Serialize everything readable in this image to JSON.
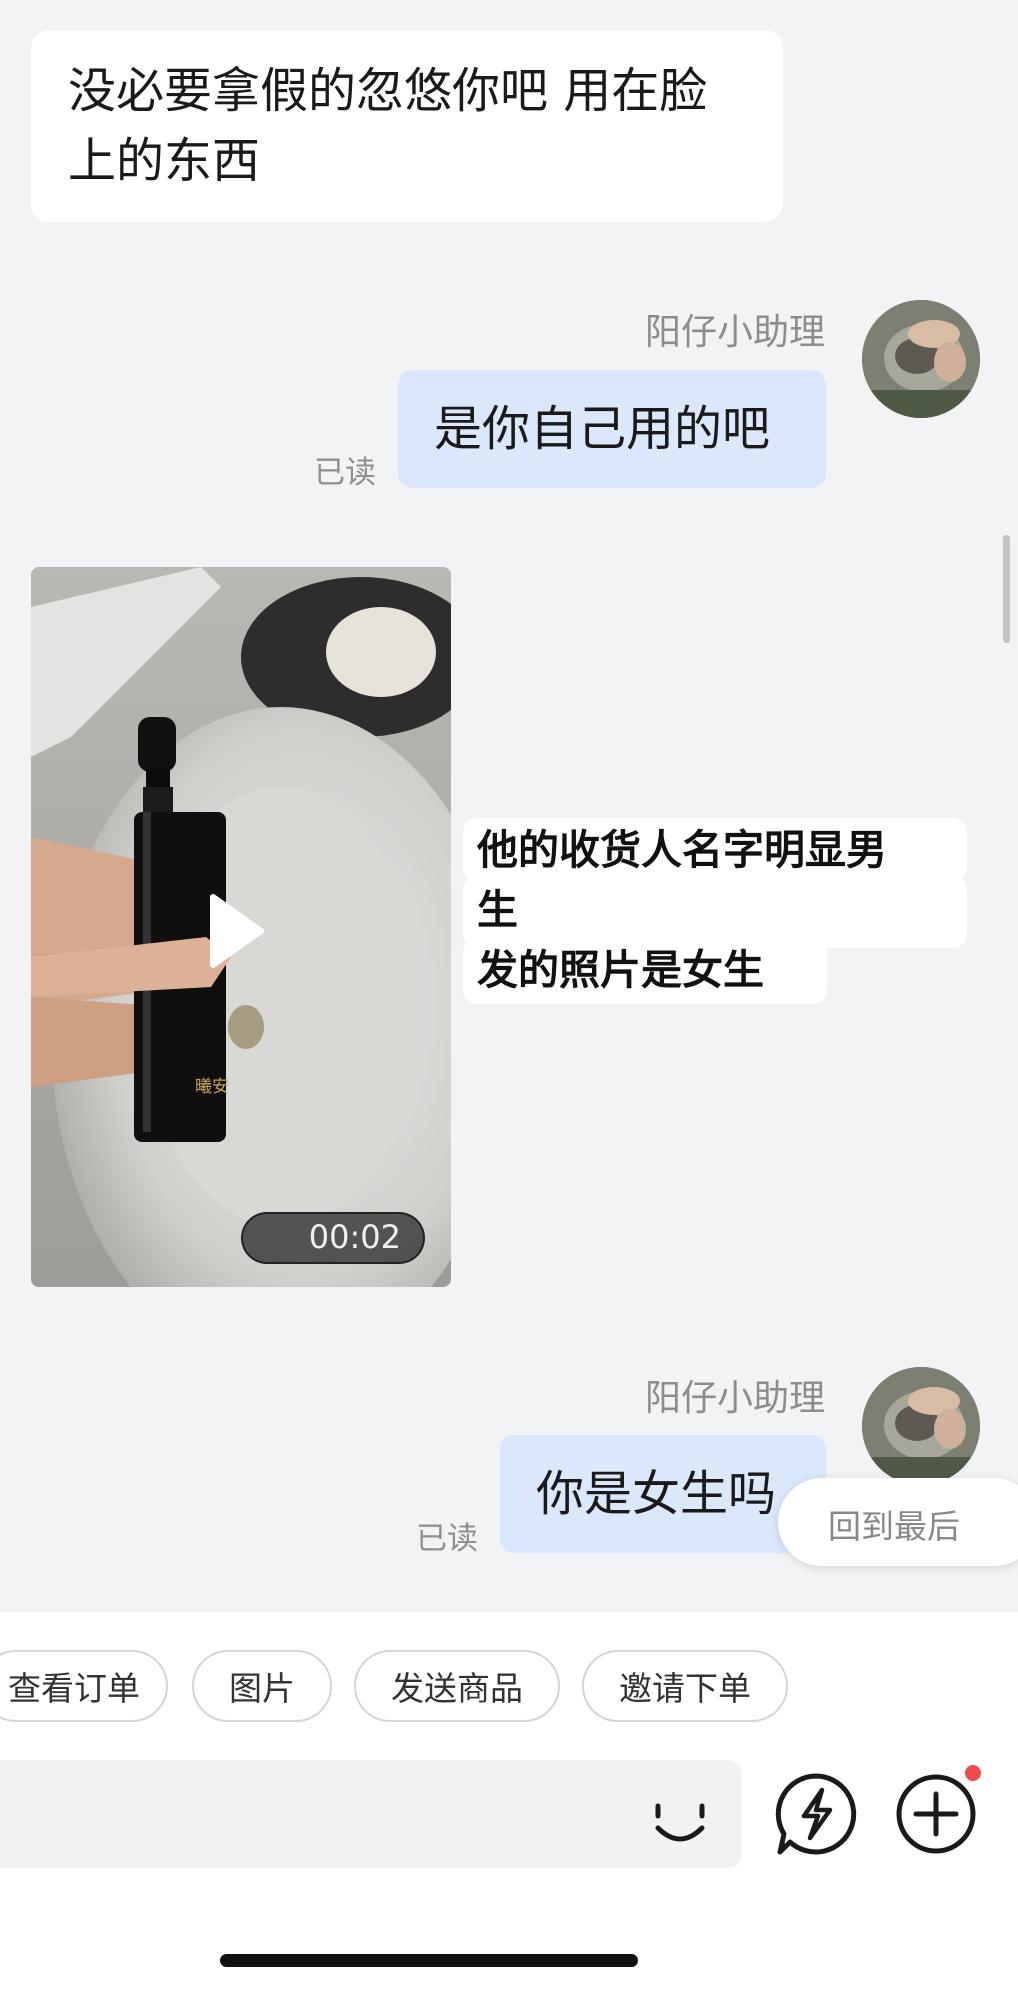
{
  "messages": [
    {
      "id": "m1",
      "side": "incoming",
      "lines": [
        "没必要拿假的忽悠你吧 用在脸",
        "上的东西"
      ]
    },
    {
      "id": "m2",
      "side": "outgoing",
      "sender": "阳仔小助理",
      "text": "是你自己用的吧",
      "read_status": "已读"
    },
    {
      "id": "m3",
      "side": "incoming",
      "type": "video",
      "duration": "00:02",
      "bottle_label": "曦安",
      "caption_lines": [
        "他的收货人名字明显男",
        "生",
        "发的照片是女生"
      ]
    },
    {
      "id": "m4",
      "side": "outgoing",
      "sender": "阳仔小助理",
      "text": "你是女生吗",
      "read_status": "已读"
    }
  ],
  "jump_to_latest": "回到最后",
  "quick_actions": [
    "查看订单",
    "图片",
    "发送商品",
    "邀请下单"
  ],
  "input": {
    "placeholder": ""
  },
  "icons": [
    "emoji-icon",
    "quick-reply-icon",
    "plus-icon"
  ],
  "colors": {
    "background": "#f2f3f5",
    "outgoing_bubble": "#dbe7fb",
    "notification_dot": "#f04b4b"
  }
}
